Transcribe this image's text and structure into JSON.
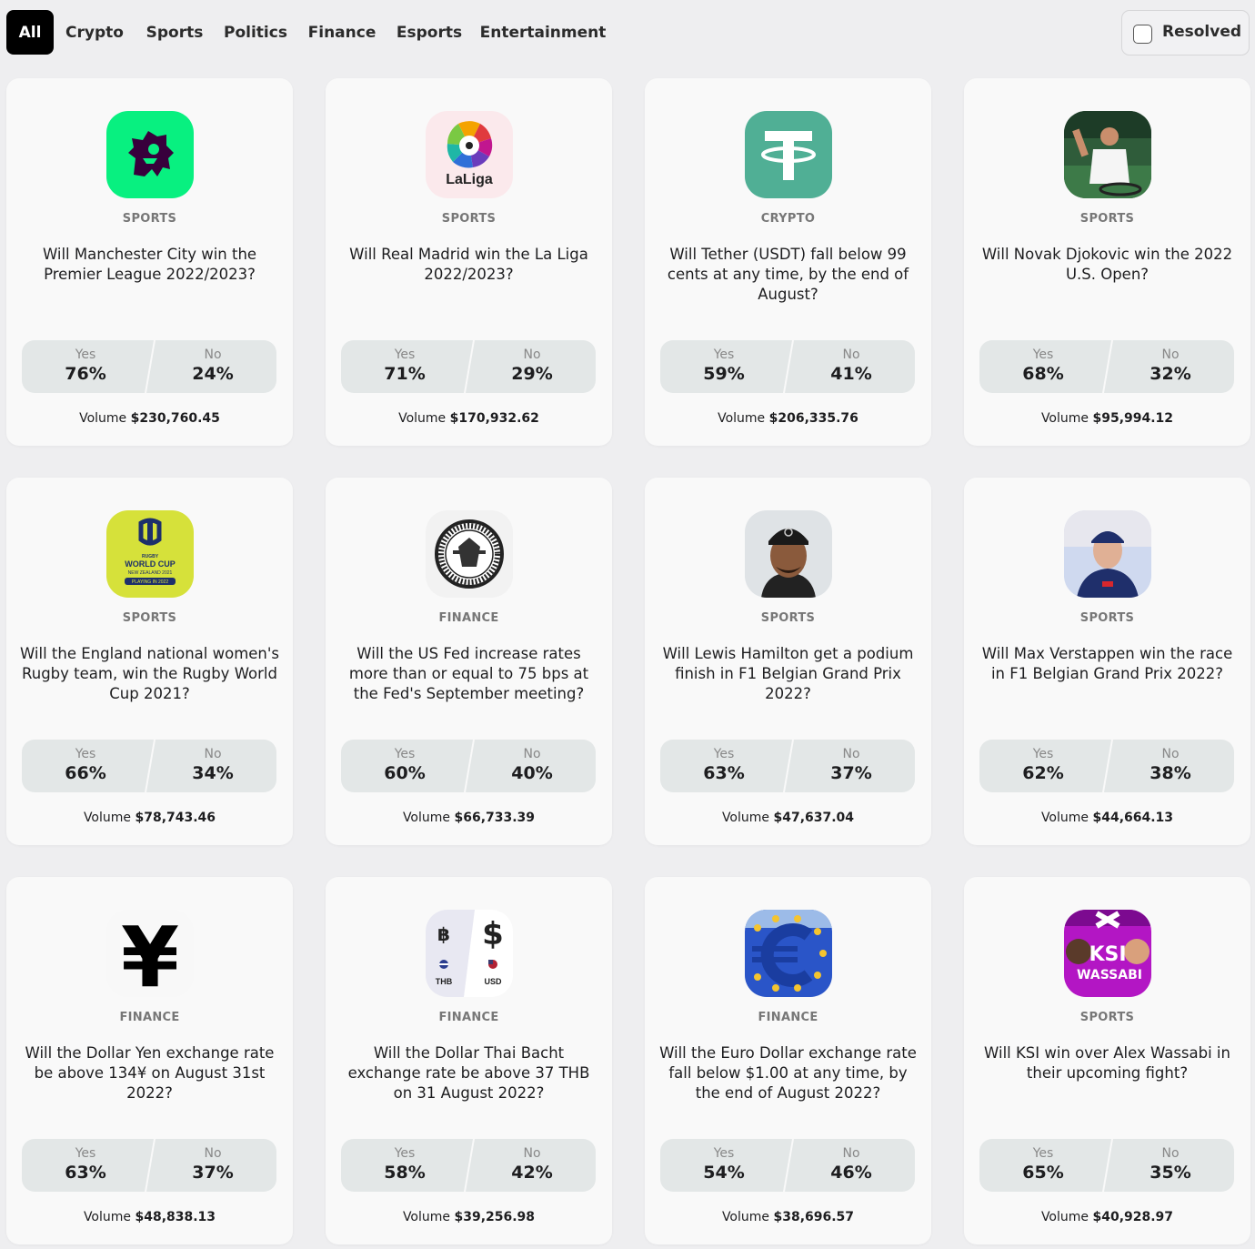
{
  "tabs": [
    {
      "label": "All",
      "active": true
    },
    {
      "label": "Crypto"
    },
    {
      "label": "Sports"
    },
    {
      "label": "Politics"
    },
    {
      "label": "Finance"
    },
    {
      "label": "Esports"
    },
    {
      "label": "Entertainment"
    }
  ],
  "resolved_label": "Resolved",
  "yes_label": "Yes",
  "no_label": "No",
  "volume_prefix": "Volume",
  "markets": [
    {
      "icon": "premier-league-logo",
      "category": "SPORTS",
      "question": "Will Manchester City win the Premier League 2022/2023?",
      "yes": "76%",
      "no": "24%",
      "volume": "$230,760.45"
    },
    {
      "icon": "laliga-logo",
      "category": "SPORTS",
      "question": "Will Real Madrid win the La Liga 2022/2023?",
      "yes": "71%",
      "no": "29%",
      "volume": "$170,932.62"
    },
    {
      "icon": "tether-logo",
      "category": "CRYPTO",
      "question": "Will Tether (USDT) fall below 99 cents at any time, by the end of August?",
      "yes": "59%",
      "no": "41%",
      "volume": "$206,335.76"
    },
    {
      "icon": "djokovic-photo",
      "category": "SPORTS",
      "question": "Will Novak Djokovic win the 2022 U.S. Open?",
      "yes": "68%",
      "no": "32%",
      "volume": "$95,994.12"
    },
    {
      "icon": "rugby-world-cup-logo",
      "category": "SPORTS",
      "question": "Will the England national women's Rugby team, win the Rugby World Cup 2021?",
      "yes": "66%",
      "no": "34%",
      "volume": "$78,743.46"
    },
    {
      "icon": "federal-reserve-seal",
      "category": "FINANCE",
      "question": "Will the US Fed increase rates more than or equal to 75 bps at the Fed's September meeting?",
      "yes": "60%",
      "no": "40%",
      "volume": "$66,733.39"
    },
    {
      "icon": "hamilton-photo",
      "category": "SPORTS",
      "question": "Will Lewis Hamilton get a podium finish in F1 Belgian Grand Prix 2022?",
      "yes": "63%",
      "no": "37%",
      "volume": "$47,637.04"
    },
    {
      "icon": "verstappen-photo",
      "category": "SPORTS",
      "question": "Will Max Verstappen win the race in F1 Belgian Grand Prix 2022?",
      "yes": "62%",
      "no": "38%",
      "volume": "$44,664.13"
    },
    {
      "icon": "yen-symbol",
      "category": "FINANCE",
      "question": "Will the Dollar Yen exchange rate be above 134¥ on August 31st 2022?",
      "yes": "63%",
      "no": "37%",
      "volume": "$48,838.13"
    },
    {
      "icon": "baht-dollar-icon",
      "category": "FINANCE",
      "question": "Will the Dollar Thai Bacht exchange rate be above 37 THB on 31 August 2022?",
      "yes": "58%",
      "no": "42%",
      "volume": "$39,256.98"
    },
    {
      "icon": "euro-sculpture-photo",
      "category": "FINANCE",
      "question": "Will the Euro Dollar exchange rate fall below $1.00 at any time, by the end of August 2022?",
      "yes": "54%",
      "no": "46%",
      "volume": "$38,696.57"
    },
    {
      "icon": "ksi-wassabi-poster",
      "category": "SPORTS",
      "question": "Will KSI win over Alex Wassabi in their upcoming fight?",
      "yes": "65%",
      "no": "35%",
      "volume": "$40,928.97"
    }
  ],
  "icon_text": {
    "laliga": "LaLiga",
    "rugby_line1": "RUGBY",
    "rugby_line2": "WORLD CUP",
    "rugby_line3": "NEW ZEALAND 2021",
    "rugby_line4": "PLAYING IN 2022",
    "yen": "¥",
    "baht": "฿",
    "dollar": "$",
    "thb": "THB",
    "usd": "USD",
    "ksi": "KSI",
    "wassabi": "WASSABI"
  }
}
